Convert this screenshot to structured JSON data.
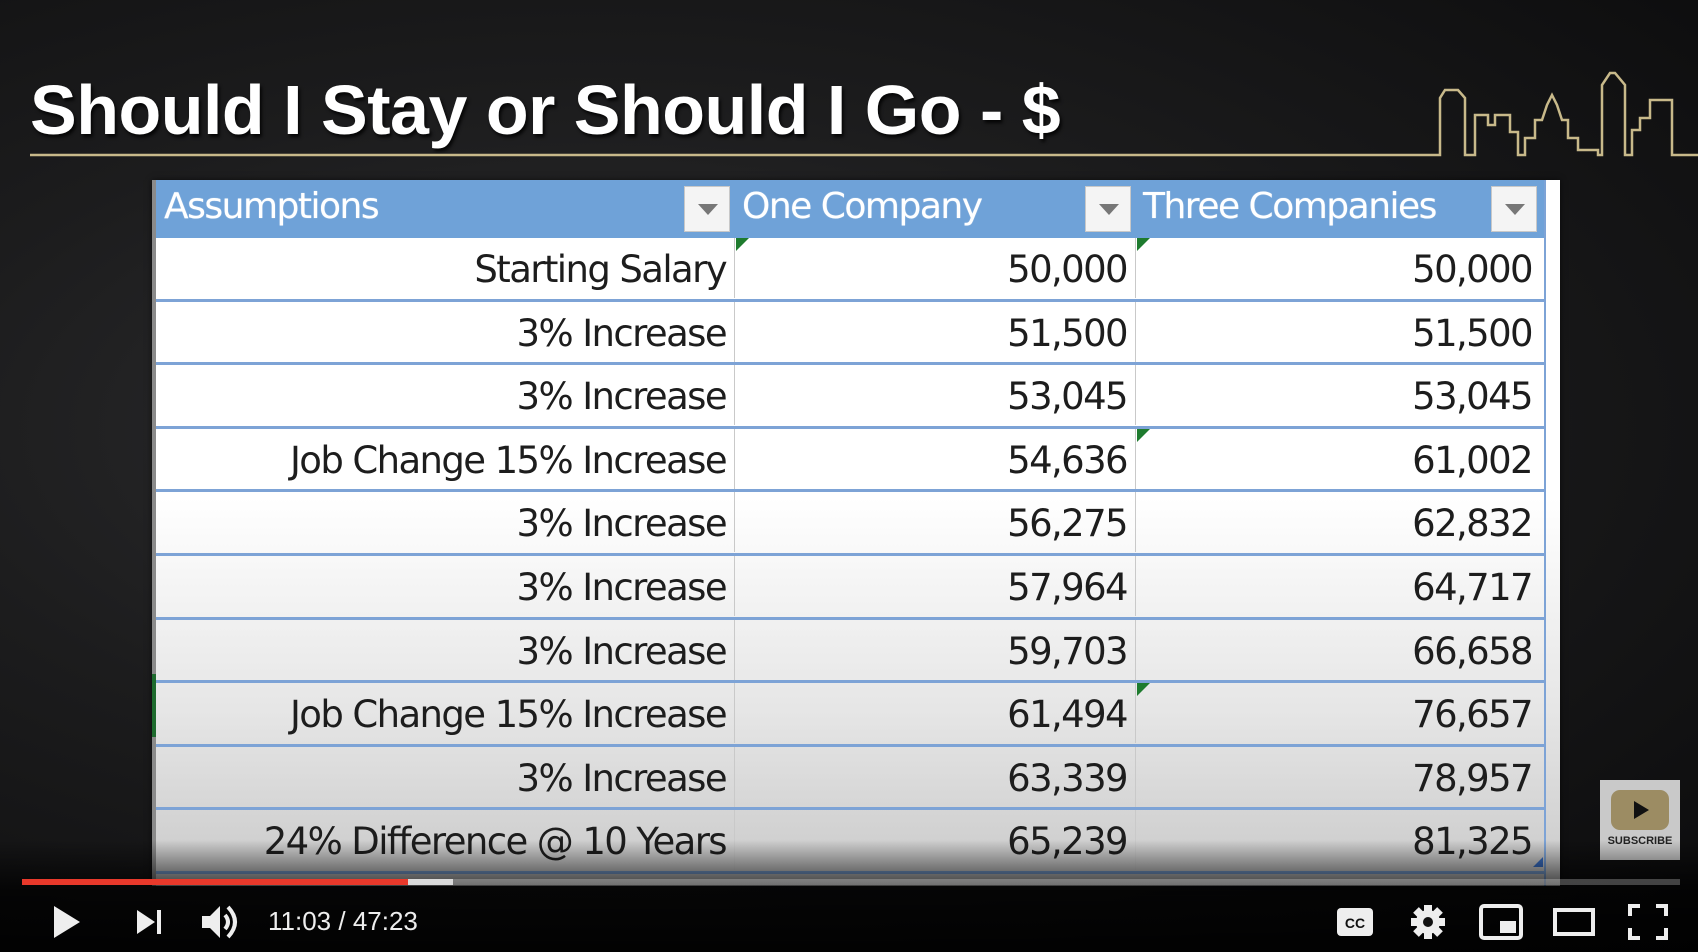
{
  "slide": {
    "title": "Should I Stay or Should I Go - $",
    "accent_color": "#c8b98a"
  },
  "table": {
    "header_color": "#6fa2d8",
    "columns": [
      {
        "label": "Assumptions",
        "filter_icon": "filter-dropdown-icon"
      },
      {
        "label": "One Company",
        "filter_icon": "filter-dropdown-icon"
      },
      {
        "label": "Three Companies",
        "filter_icon": "filter-dropdown-icon"
      }
    ],
    "rows": [
      {
        "assumption": "Starting Salary",
        "one_company": "50,000",
        "three_companies": "50,000"
      },
      {
        "assumption": "3% Increase",
        "one_company": "51,500",
        "three_companies": "51,500"
      },
      {
        "assumption": "3% Increase",
        "one_company": "53,045",
        "three_companies": "53,045"
      },
      {
        "assumption": "Job Change 15% Increase",
        "one_company": "54,636",
        "three_companies": "61,002"
      },
      {
        "assumption": "3% Increase",
        "one_company": "56,275",
        "three_companies": "62,832"
      },
      {
        "assumption": "3% Increase",
        "one_company": "57,964",
        "three_companies": "64,717"
      },
      {
        "assumption": "3% Increase",
        "one_company": "59,703",
        "three_companies": "66,658"
      },
      {
        "assumption": "Job Change 15% Increase",
        "one_company": "61,494",
        "three_companies": "76,657"
      },
      {
        "assumption": "3% Increase",
        "one_company": "63,339",
        "three_companies": "78,957"
      },
      {
        "assumption": "24% Difference @ 10 Years",
        "one_company": "65,239",
        "three_companies": "81,325"
      }
    ],
    "error_indicator_cells": [
      {
        "row": 0,
        "col": 1
      },
      {
        "row": 0,
        "col": 2
      },
      {
        "row": 3,
        "col": 2
      },
      {
        "row": 7,
        "col": 2
      }
    ]
  },
  "subscribe": {
    "label": "SUBSCRIBE",
    "icon": "youtube-play-icon"
  },
  "player": {
    "current_time": "11:03",
    "separator": " / ",
    "duration": "47:23",
    "played_fraction": 0.233,
    "buffered_fraction": 0.26,
    "progress_color": "#e8392b",
    "buttons": {
      "play": "play-icon",
      "next": "next-icon",
      "volume": "volume-icon",
      "captions": "CC",
      "settings": "gear-icon",
      "miniplayer": "miniplayer-icon",
      "theater": "theater-mode-icon",
      "fullscreen": "fullscreen-icon"
    }
  }
}
